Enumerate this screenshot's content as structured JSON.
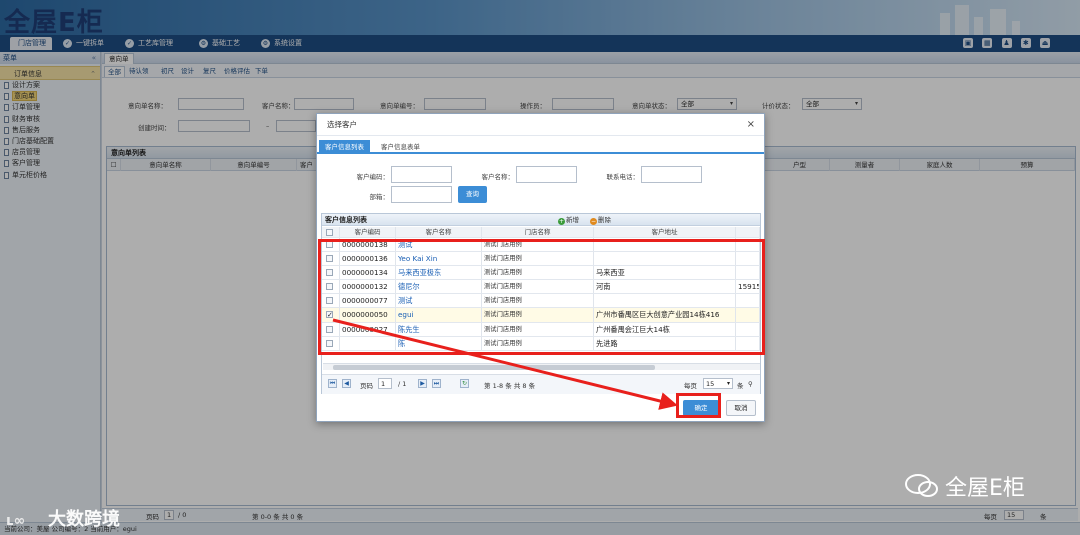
{
  "app": {
    "logo_text": "全屋E柜"
  },
  "menu": [
    {
      "label": "门店管理",
      "active": true
    },
    {
      "label": "一键拆单"
    },
    {
      "label": "工艺库管理"
    },
    {
      "label": "基础工艺"
    },
    {
      "label": "系统设置"
    }
  ],
  "sidebar": {
    "header": "菜单",
    "collapse": "«",
    "section": "订单信息",
    "items": [
      "设计方案",
      "意向单",
      "订单管理",
      "财务审核",
      "售后服务",
      "门店基础配置",
      "店员管理",
      "客户管理",
      "单元柜价格"
    ],
    "selected_index": 1
  },
  "main": {
    "tab_label": "意向单",
    "filter_tabs": [
      "全部",
      "待认领",
      "初尺",
      "设计",
      "复尺",
      "价格评估",
      "下单"
    ],
    "filters": {
      "intent_name_label": "意向单名称：",
      "customer_name_label": "客户名称：",
      "intent_no_label": "意向单编号：",
      "operator_label": "操作员：",
      "intent_status_label": "意向单状态：",
      "intent_status_value": "全部",
      "price_status_label": "计价状态：",
      "price_status_value": "全部",
      "created_label": "创建时间：",
      "range_dash": "–"
    },
    "grid_title": "意向单列表",
    "grid_columns": [
      "意向单名称",
      "意向单编号",
      "客户",
      "户型",
      "测量者",
      "家庭人数",
      "预算"
    ],
    "pager": {
      "page_label": "页码",
      "page_value": "1",
      "of": "/ 0",
      "range": "第 0-0 条  共 0 条",
      "per_page_label": "每页",
      "per_page_value": "15",
      "suffix": "条"
    }
  },
  "statusbar": "当前公司：美屋  公司编号：2  当前用户：egui",
  "dialog": {
    "title": "选择客户",
    "close": "×",
    "tabs": [
      {
        "label": "客户信息列表",
        "active": true
      },
      {
        "label": "客户信息表单"
      }
    ],
    "form": {
      "code_label": "客户编码：",
      "name_label": "客户名称：",
      "phone_label": "联系电话：",
      "dept_label": "部箱：",
      "query_button": "查询"
    },
    "list_title": "客户信息列表",
    "add_label": "新增",
    "delete_label": "删除",
    "columns": [
      "客户编码",
      "客户名称",
      "门店名称",
      "客户地址"
    ],
    "rows": [
      {
        "code": "0000000138",
        "name": "测试",
        "store": "测试门店用例",
        "address": "",
        "extra": "",
        "checked": false
      },
      {
        "code": "0000000136",
        "name": "Yeo Kai Xin",
        "store": "测试门店用例",
        "address": "",
        "extra": "",
        "checked": false
      },
      {
        "code": "0000000134",
        "name": "马来西亚极东",
        "store": "测试门店用例",
        "address": "马来西亚",
        "extra": "",
        "checked": false
      },
      {
        "code": "0000000132",
        "name": "德尼尔",
        "store": "测试门店用例",
        "address": "河南",
        "extra": "15915",
        "checked": false
      },
      {
        "code": "0000000077",
        "name": "测试",
        "store": "测试门店用例",
        "address": "",
        "extra": "",
        "checked": false
      },
      {
        "code": "0000000050",
        "name": "egui",
        "store": "测试门店用例",
        "address": "广州市番禺区巨大创意产业园14栋416",
        "extra": "",
        "checked": true
      },
      {
        "code": "0000000027",
        "name": "陈先生",
        "store": "测试门店用例",
        "address": "广州番禺会江巨大14栋",
        "extra": "",
        "checked": false
      },
      {
        "code": "",
        "name": "陈",
        "store": "测试门店用例",
        "address": "先进路",
        "extra": "",
        "checked": false
      }
    ],
    "pager": {
      "page_label": "页码",
      "page_value": "1",
      "of": "/ 1",
      "range": "第 1-8 条  共 8 条",
      "per_page_label": "每页",
      "per_page_value": "15",
      "suffix": "条"
    },
    "ok_button": "确定",
    "cancel_button": "取消"
  },
  "watermarks": {
    "left": "大数跨境",
    "right": "全屋E柜"
  },
  "colors": {
    "annotation": "#e8201c",
    "primary_button": "#3c8dd6",
    "menubar": "#1e4d84"
  }
}
